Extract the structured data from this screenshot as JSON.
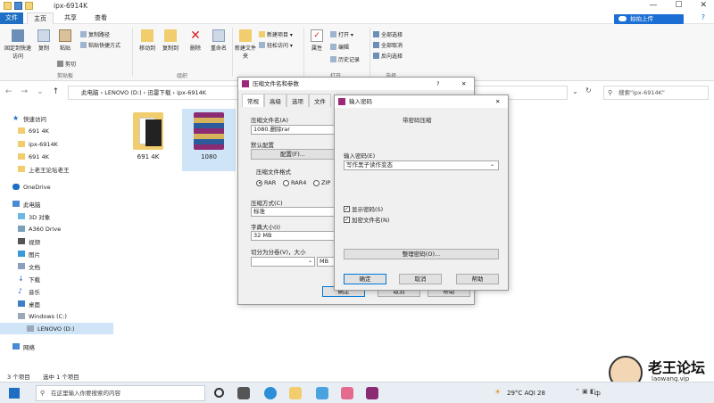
{
  "window": {
    "title": "ipx-6914K",
    "controls": [
      "—",
      "☐",
      "✕"
    ],
    "upload_label": "拍拍上传"
  },
  "tabs": [
    "文件",
    "主页",
    "共享",
    "查看"
  ],
  "ribbon": {
    "pin_label": "固定到快速访问",
    "copy_label": "复制",
    "paste_label": "粘贴",
    "copy_path_label": "复制路径",
    "paste_shortcut_label": "粘贴快捷方式",
    "cut_label": "剪切",
    "move_to_label": "移动到",
    "copy_to_label": "复制到",
    "delete_label": "删除",
    "rename_label": "重命名",
    "new_folder_label": "新建文件夹",
    "new_item_label": "新建项目 ▾",
    "easy_access_label": "轻松访问 ▾",
    "properties_label": "属性",
    "open_label": "打开 ▾",
    "edit_label": "编辑",
    "history_label": "历史记录",
    "select_all_label": "全部选择",
    "select_none_label": "全部取消",
    "invert_label": "反向选择",
    "group_clipboard": "剪贴板",
    "group_organize": "组织",
    "group_open": "打开",
    "group_select": "选择"
  },
  "address": {
    "path": "此电脑  ›  LENOVO (D:)  ›  迅雷下载  ›  ipx-6914K",
    "search_placeholder": "搜索\"ipx-6914K\""
  },
  "nav": {
    "items": [
      {
        "label": "快速访问"
      },
      {
        "label": "691 4K"
      },
      {
        "label": "ipx-6914K"
      },
      {
        "label": "691 4K"
      },
      {
        "label": "上老王论坛老王"
      },
      {
        "label": "OneDrive"
      },
      {
        "label": "此电脑"
      },
      {
        "label": "3D 对象"
      },
      {
        "label": "A360 Drive"
      },
      {
        "label": "视频"
      },
      {
        "label": "图片"
      },
      {
        "label": "文档"
      },
      {
        "label": "下载"
      },
      {
        "label": "音乐"
      },
      {
        "label": "桌面"
      },
      {
        "label": "Windows (C:)"
      },
      {
        "label": "LENOVO (D:)"
      },
      {
        "label": "网络"
      }
    ]
  },
  "files": [
    {
      "name": "691 4K"
    },
    {
      "name": "1080"
    }
  ],
  "status": {
    "count": "3 个项目",
    "selected": "选中 1 个项目"
  },
  "archive_dialog": {
    "title": "压缩文件名和参数",
    "tabs": [
      "常规",
      "高级",
      "选项",
      "文件"
    ],
    "filename_label": "压缩文件名(A)",
    "filename_value": "1080.删除rar",
    "profile_label": "默认配置",
    "profile_button": "配置(F)...",
    "format_label": "压缩文件格式",
    "format_options": [
      "RAR",
      "RAR4",
      "ZIP"
    ],
    "method_label": "压缩方式(C)",
    "method_value": "标准",
    "dict_label": "字典大小(I)",
    "dict_value": "32 MB",
    "split_label": "切分为分卷(V)，大小",
    "split_unit": "MB",
    "ok": "确定",
    "cancel": "取消",
    "help": "帮助",
    "title_controls": [
      "?",
      "✕"
    ]
  },
  "password_dialog": {
    "title": "输入密码",
    "subtitle": "带密码压缩",
    "password_label": "输入密码(E)",
    "password_value": "写作黑子读作变态",
    "show_password": "显示密码(S)",
    "encrypt_names": "加密文件名(N)",
    "manage": "整理密码(O)...",
    "ok": "确定",
    "cancel": "取消",
    "help": "帮助",
    "close": "✕"
  },
  "taskbar": {
    "search_placeholder": "在这里输入你要搜索的内容",
    "weather": "29°C  AQI 28",
    "ime": "中"
  },
  "watermark": {
    "title": "老王论坛",
    "url": "laowang.vip"
  }
}
